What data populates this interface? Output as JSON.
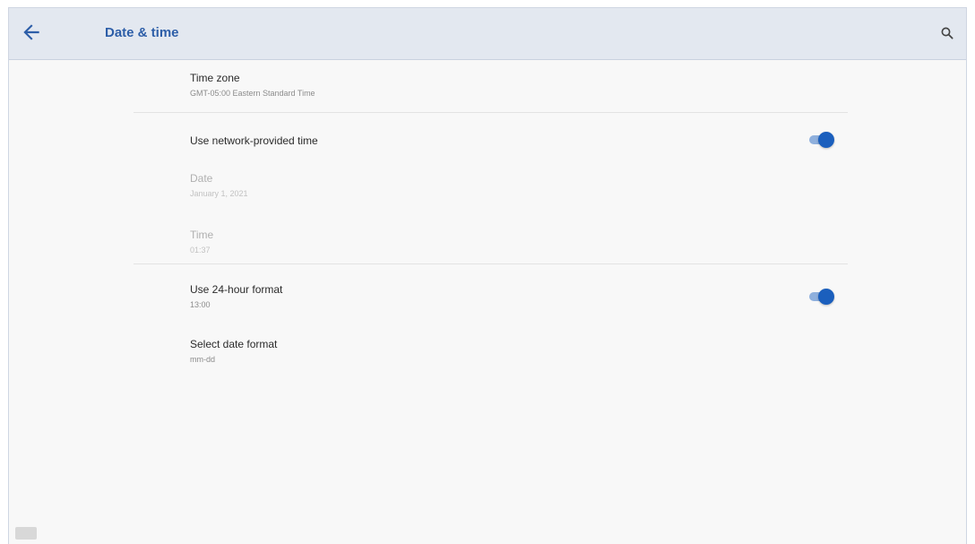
{
  "appbar": {
    "title": "Date & time",
    "back_icon": "arrow-back-icon",
    "search_icon": "search-icon"
  },
  "settings": {
    "time_zone": {
      "title": "Time zone",
      "summary": "GMT-05:00 Eastern Standard Time"
    },
    "network_time": {
      "title": "Use network-provided time",
      "enabled": true
    },
    "date": {
      "title": "Date",
      "summary": "January 1, 2021",
      "disabled": true
    },
    "time": {
      "title": "Time",
      "summary": "01:37",
      "disabled": true
    },
    "hour24": {
      "title": "Use 24-hour format",
      "summary": "13:00",
      "enabled": true
    },
    "date_format": {
      "title": "Select date format",
      "summary": "mm-dd"
    }
  },
  "colors": {
    "accent": "#1b5fbd",
    "appbar_bg": "#e3e8f0",
    "title_color": "#2d5ea8"
  }
}
